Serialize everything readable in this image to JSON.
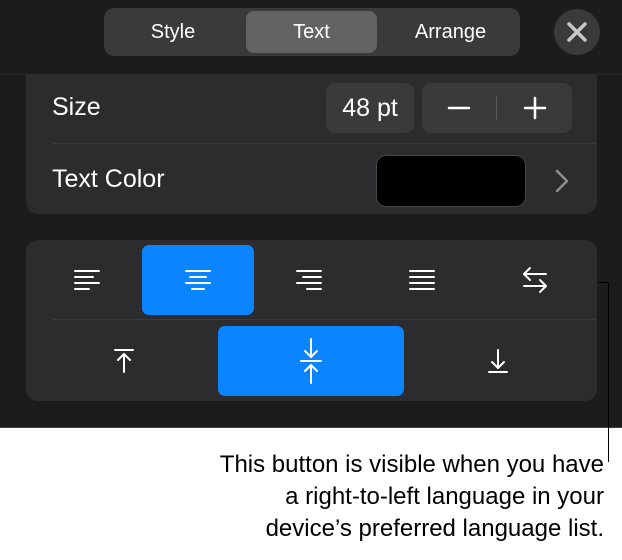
{
  "tabs": [
    {
      "label": "Style",
      "active": false
    },
    {
      "label": "Text",
      "active": true
    },
    {
      "label": "Arrange",
      "active": false
    }
  ],
  "close_icon": "close-icon",
  "size_row": {
    "label": "Size",
    "value": "48 pt",
    "decrement_icon": "minus-icon",
    "increment_icon": "plus-icon"
  },
  "text_color_row": {
    "label": "Text Color",
    "swatch_color": "#000000",
    "chevron_icon": "chevron-right-icon"
  },
  "alignment": {
    "horizontal": [
      {
        "name": "align-left",
        "icon": "align-left-icon",
        "active": false
      },
      {
        "name": "align-center",
        "icon": "align-center-icon",
        "active": true
      },
      {
        "name": "align-right",
        "icon": "align-right-icon",
        "active": false
      },
      {
        "name": "justify",
        "icon": "justify-icon",
        "active": false
      },
      {
        "name": "text-direction",
        "icon": "text-direction-icon",
        "active": false
      }
    ],
    "vertical": [
      {
        "name": "align-top",
        "icon": "align-top-icon",
        "active": false
      },
      {
        "name": "align-middle",
        "icon": "align-middle-icon",
        "active": true
      },
      {
        "name": "align-bottom",
        "icon": "align-bottom-icon",
        "active": false
      }
    ]
  },
  "callout": {
    "lines": [
      "This button is visible when you have",
      "a right-to-left language in your",
      "device’s preferred language list."
    ]
  },
  "colors": {
    "panel_bg": "#1c1c1e",
    "card_bg": "#2c2c2e",
    "control_bg": "#3a3a3c",
    "active_tab": "#636366",
    "accent": "#0a84ff"
  }
}
